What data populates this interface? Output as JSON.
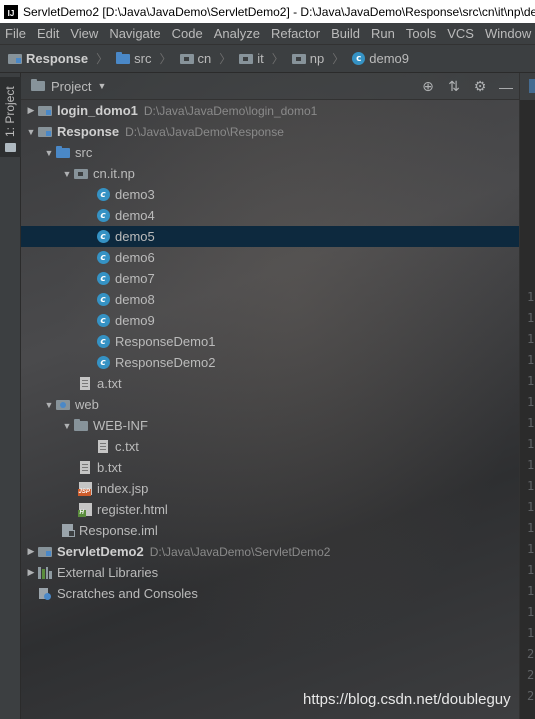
{
  "window": {
    "title": "ServletDemo2 [D:\\Java\\JavaDemo\\ServletDemo2] - D:\\Java\\JavaDemo\\Response\\src\\cn\\it\\np\\demo9.java [Response] - IntelliJ IDEA",
    "app_icon_text": "IJ"
  },
  "menu": [
    "File",
    "Edit",
    "View",
    "Navigate",
    "Code",
    "Analyze",
    "Refactor",
    "Build",
    "Run",
    "Tools",
    "VCS",
    "Window"
  ],
  "breadcrumb": [
    {
      "label": "Response",
      "icon": "module-folder-icon"
    },
    {
      "label": "src",
      "icon": "source-folder-icon"
    },
    {
      "label": "cn",
      "icon": "package-icon"
    },
    {
      "label": "it",
      "icon": "package-icon"
    },
    {
      "label": "np",
      "icon": "package-icon"
    },
    {
      "label": "demo9",
      "icon": "class-icon"
    }
  ],
  "toolwindow": {
    "stripe_label": "1: Project",
    "view_selector": "Project",
    "header_icons": [
      "locate-icon",
      "collapse-all-icon",
      "settings-gear-icon",
      "minimize-icon"
    ]
  },
  "tree": [
    {
      "label": "login_domo1",
      "path": "D:\\Java\\JavaDemo\\login_domo1",
      "icon": "module-folder",
      "bold": true,
      "arrow": "right",
      "level": 0
    },
    {
      "label": "Response",
      "path": "D:\\Java\\JavaDemo\\Response",
      "icon": "module-folder",
      "bold": true,
      "arrow": "down",
      "level": 0
    },
    {
      "label": "src",
      "icon": "source-folder",
      "arrow": "down",
      "level": 1
    },
    {
      "label": "cn.it.np",
      "icon": "package",
      "arrow": "down",
      "level": 2
    },
    {
      "label": "demo3",
      "icon": "class",
      "level": 3
    },
    {
      "label": "demo4",
      "icon": "class",
      "level": 3
    },
    {
      "label": "demo5",
      "icon": "class",
      "level": 3,
      "selected": true
    },
    {
      "label": "demo6",
      "icon": "class",
      "level": 3
    },
    {
      "label": "demo7",
      "icon": "class",
      "level": 3
    },
    {
      "label": "demo8",
      "icon": "class",
      "level": 3
    },
    {
      "label": "demo9",
      "icon": "class",
      "level": 3
    },
    {
      "label": "ResponseDemo1",
      "icon": "class",
      "level": 3
    },
    {
      "label": "ResponseDemo2",
      "icon": "class",
      "level": 3
    },
    {
      "label": "a.txt",
      "icon": "text-file",
      "level": 2
    },
    {
      "label": "web",
      "icon": "web-folder",
      "arrow": "down",
      "level": 1
    },
    {
      "label": "WEB-INF",
      "icon": "folder",
      "arrow": "down",
      "level": 2
    },
    {
      "label": "c.txt",
      "icon": "text-file",
      "level": 3
    },
    {
      "label": "b.txt",
      "icon": "text-file",
      "level": 2
    },
    {
      "label": "index.jsp",
      "icon": "jsp-file",
      "level": 2
    },
    {
      "label": "register.html",
      "icon": "html-file",
      "level": 2
    },
    {
      "label": "Response.iml",
      "icon": "iml-file",
      "level": 1
    },
    {
      "label": "ServletDemo2",
      "path": "D:\\Java\\JavaDemo\\ServletDemo2",
      "icon": "module-folder",
      "bold": true,
      "arrow": "right",
      "level": 0
    },
    {
      "label": "External Libraries",
      "icon": "libraries",
      "arrow": "right",
      "level": 0
    },
    {
      "label": "Scratches and Consoles",
      "icon": "scratches",
      "level": 0
    }
  ],
  "editor_gutter_digits": [
    "1",
    "1",
    "1",
    "1",
    "1",
    "1",
    "1",
    "1",
    "1",
    "1",
    "1",
    "1",
    "1",
    "1",
    "1",
    "1",
    "1",
    "2",
    "2",
    "2",
    "2",
    "2",
    "2",
    "2",
    "2",
    "2"
  ],
  "watermark": "https://blog.csdn.net/doubleguy",
  "colors": {
    "selection": "#0d293e",
    "class_icon": "#3592c4",
    "source_folder": "#4a88c7",
    "panel_bg": "#3c3f41"
  }
}
